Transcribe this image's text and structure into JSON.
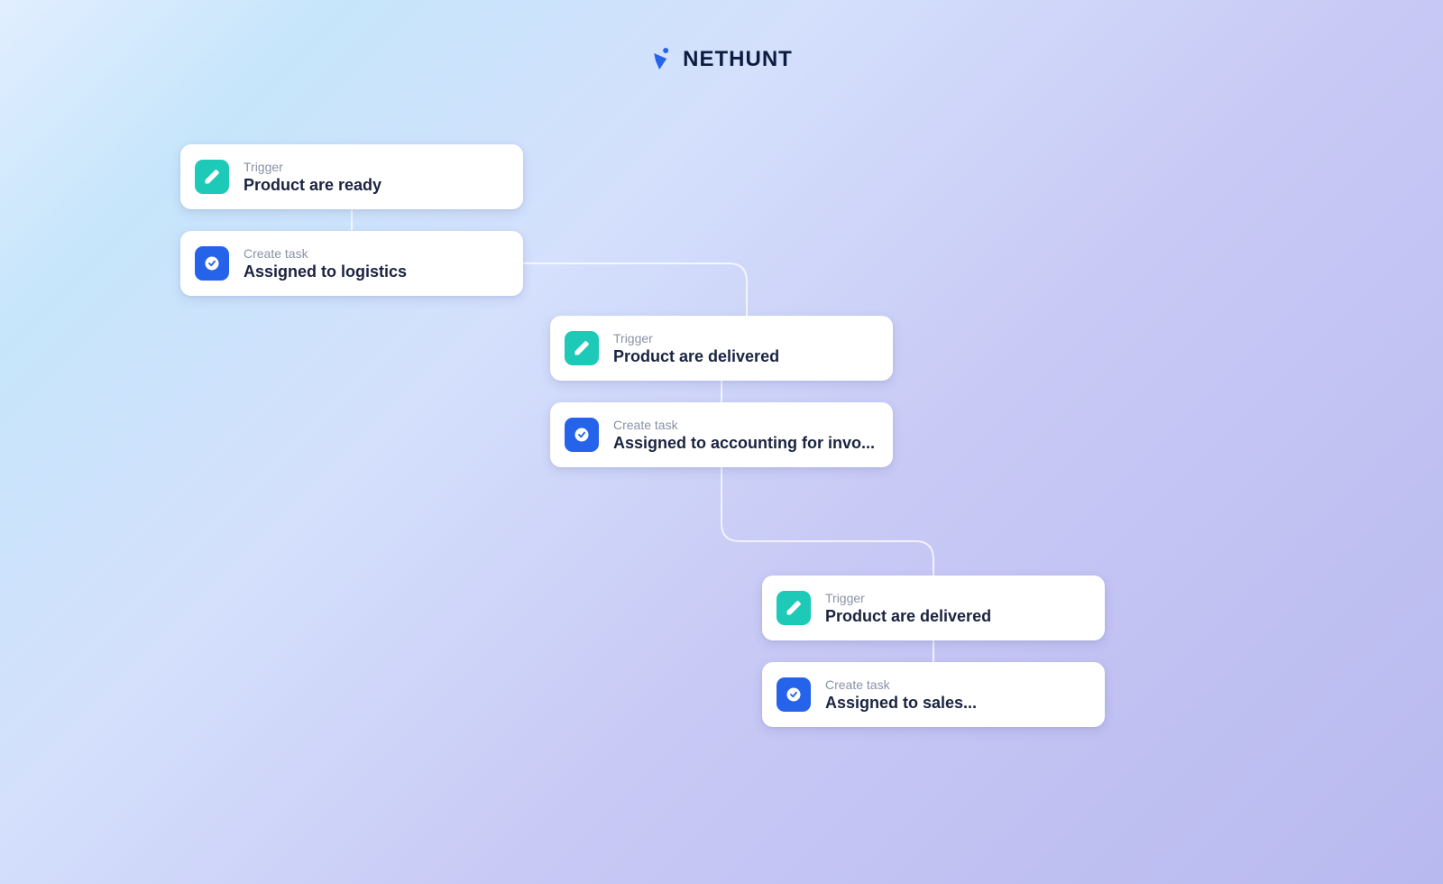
{
  "brand": {
    "name": "NETHUNT"
  },
  "nodes": {
    "trigger1": {
      "label": "Trigger",
      "title": "Product are ready"
    },
    "task1": {
      "label": "Create task",
      "title": "Assigned to logistics"
    },
    "trigger2": {
      "label": "Trigger",
      "title": "Product are delivered"
    },
    "task2": {
      "label": "Create task",
      "title": "Assigned to accounting for invo..."
    },
    "trigger3": {
      "label": "Trigger",
      "title": "Product are delivered"
    },
    "task3": {
      "label": "Create task",
      "title": "Assigned to sales..."
    }
  },
  "icons": {
    "pencil": "pencil-icon",
    "check": "check-circle-icon"
  },
  "colors": {
    "trigger_bg": "#1dc9b7",
    "task_bg": "#2563eb",
    "card_bg": "#ffffff",
    "label": "#8a92a6",
    "title": "#1a2340"
  }
}
